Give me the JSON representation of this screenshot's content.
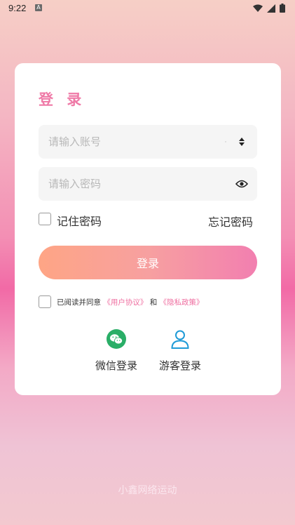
{
  "status_bar": {
    "time": "9:22",
    "notif_badge": "A"
  },
  "login": {
    "title": "登 录",
    "account_placeholder": "请输入账号",
    "password_placeholder": "请输入密码",
    "remember_label": "记住密码",
    "forgot_label": "忘记密码",
    "login_button": "登录",
    "agree_prefix": "已阅读并同意",
    "user_agreement": "《用户协议》",
    "and_text": "和",
    "privacy_policy": "《隐私政策》",
    "wechat_login": "微信登录",
    "guest_login": "游客登录"
  },
  "footer": {
    "brand": "小鑫网络运动"
  },
  "colors": {
    "accent": "#ef7aa7",
    "wechat_green": "#2aae67",
    "guest_blue": "#1f9bd7"
  },
  "icons": {
    "dropdown": "up-down-chevron-icon",
    "password_toggle": "eye-icon",
    "wechat": "wechat-icon",
    "guest": "user-icon",
    "wifi": "wifi-icon",
    "signal": "signal-icon",
    "battery": "battery-icon"
  }
}
